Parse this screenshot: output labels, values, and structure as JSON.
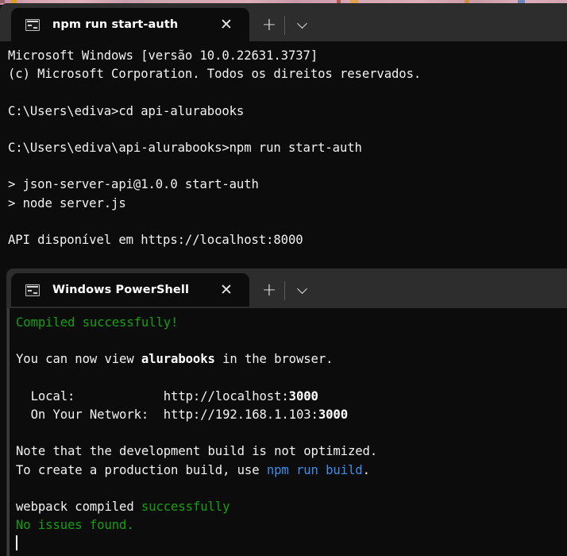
{
  "desktop": {
    "wallpaper_accent": "#d3a4b2"
  },
  "theme": {
    "titlebar_bg": "#2d2d2d",
    "terminal_bg": "#0c0c0c",
    "foreground": "#cccccc",
    "green": "#13a10e",
    "bright_green": "#16c60c",
    "blue": "#3b8eea",
    "white": "#f2f2f2"
  },
  "windows": [
    {
      "id": "command-prompt-window",
      "tab": {
        "icon": "console-icon",
        "title": "npm run start-auth",
        "close_label": "✕"
      },
      "controls": {
        "new_tab_label": "+",
        "dropdown_label": "chevron-down-icon"
      },
      "lines": [
        {
          "segments": [
            {
              "text": "Microsoft Windows [versão 10.0.22631.3737]",
              "style": "wht"
            }
          ]
        },
        {
          "segments": [
            {
              "text": "(c) Microsoft Corporation. Todos os direitos reservados.",
              "style": "wht"
            }
          ]
        },
        {
          "segments": [
            {
              "text": "",
              "style": "wht"
            }
          ]
        },
        {
          "segments": [
            {
              "text": "C:\\Users\\ediva>cd api-alurabooks",
              "style": "wht"
            }
          ]
        },
        {
          "segments": [
            {
              "text": "",
              "style": "wht"
            }
          ]
        },
        {
          "segments": [
            {
              "text": "C:\\Users\\ediva\\api-alurabooks>npm run start-auth",
              "style": "wht"
            }
          ]
        },
        {
          "segments": [
            {
              "text": "",
              "style": "wht"
            }
          ]
        },
        {
          "segments": [
            {
              "text": "> json-server-api@1.0.0 start-auth",
              "style": "wht"
            }
          ]
        },
        {
          "segments": [
            {
              "text": "> node server.js",
              "style": "wht"
            }
          ]
        },
        {
          "segments": [
            {
              "text": "",
              "style": "wht"
            }
          ]
        },
        {
          "segments": [
            {
              "text": "API disponível em https://localhost:8000",
              "style": "wht"
            }
          ]
        }
      ]
    },
    {
      "id": "powershell-window",
      "tab": {
        "icon": "console-icon",
        "title": "Windows PowerShell",
        "close_label": "✕"
      },
      "controls": {
        "new_tab_label": "+",
        "dropdown_label": "chevron-down-icon"
      },
      "lines": [
        {
          "segments": [
            {
              "text": "Compiled successfully!",
              "style": "grn"
            }
          ]
        },
        {
          "segments": [
            {
              "text": "",
              "style": "wht"
            }
          ]
        },
        {
          "segments": [
            {
              "text": "You can now view ",
              "style": "wht"
            },
            {
              "text": "alurabooks",
              "style": "bld"
            },
            {
              "text": " in the browser.",
              "style": "wht"
            }
          ]
        },
        {
          "segments": [
            {
              "text": "",
              "style": "wht"
            }
          ]
        },
        {
          "segments": [
            {
              "text": "  Local:            http://localhost:",
              "style": "wht"
            },
            {
              "text": "3000",
              "style": "bld"
            }
          ]
        },
        {
          "segments": [
            {
              "text": "  On Your Network:  http://192.168.1.103:",
              "style": "wht"
            },
            {
              "text": "3000",
              "style": "bld"
            }
          ]
        },
        {
          "segments": [
            {
              "text": "",
              "style": "wht"
            }
          ]
        },
        {
          "segments": [
            {
              "text": "Note that the development build is not optimized.",
              "style": "wht"
            }
          ]
        },
        {
          "segments": [
            {
              "text": "To create a production build, use ",
              "style": "wht"
            },
            {
              "text": "npm run build",
              "style": "blu"
            },
            {
              "text": ".",
              "style": "wht"
            }
          ]
        },
        {
          "segments": [
            {
              "text": "",
              "style": "wht"
            }
          ]
        },
        {
          "segments": [
            {
              "text": "webpack compiled ",
              "style": "wht"
            },
            {
              "text": "successfully",
              "style": "grn"
            }
          ]
        },
        {
          "segments": [
            {
              "text": "No issues found.",
              "style": "grn"
            }
          ]
        },
        {
          "segments": [
            {
              "text": "",
              "style": "cursor"
            }
          ]
        }
      ]
    }
  ]
}
